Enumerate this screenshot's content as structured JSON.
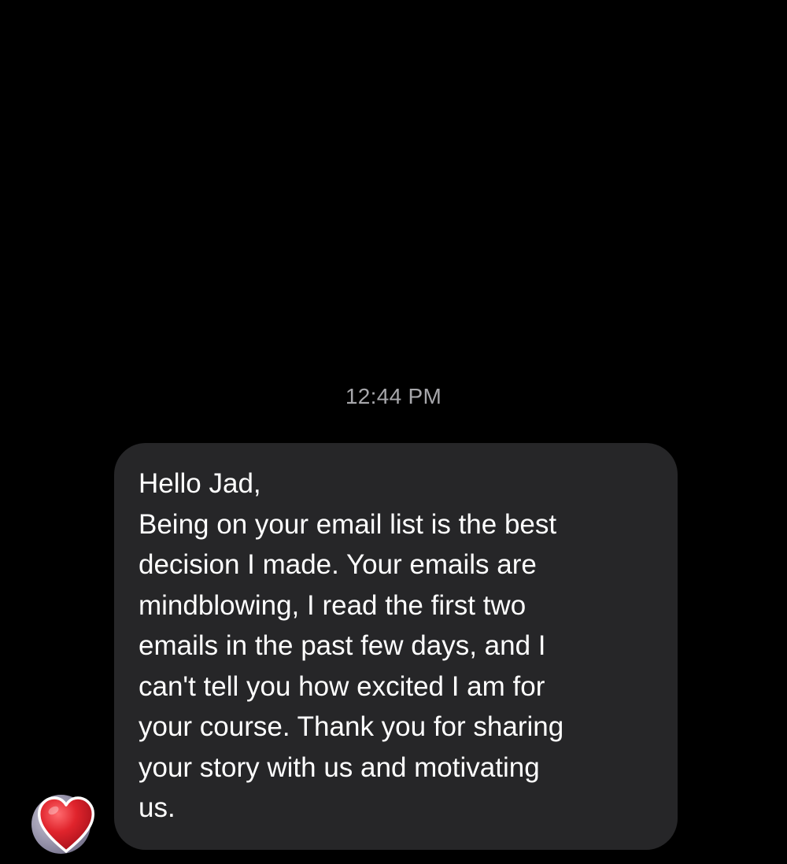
{
  "thread": {
    "timestamp": "12:44 PM"
  },
  "message": {
    "lines": [
      "Hello Jad,",
      "Being on your email list is the best",
      "decision I made. Your emails are",
      "mindblowing, I read the first two",
      "emails in the past few days, and I",
      "can't tell you how excited I am for",
      "your course. Thank you for sharing",
      "your story with us and motivating",
      "us."
    ],
    "reaction": "heart-icon"
  },
  "colors": {
    "background": "#000000",
    "bubble": "#262628",
    "text": "#ffffff",
    "timestamp": "#a7a7ab",
    "heart": "#e0242c"
  }
}
